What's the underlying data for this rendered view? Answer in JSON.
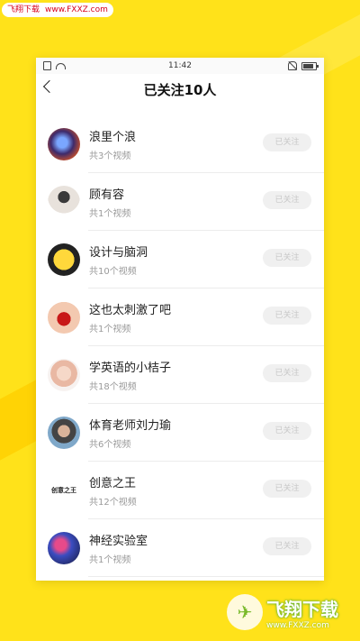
{
  "watermark": {
    "top_brand": "飞翔下载",
    "top_url": "www.FXXZ.com",
    "bottom_title": "飞翔下载",
    "bottom_url": "www.FXXZ.com"
  },
  "statusbar": {
    "time": "11:42"
  },
  "navbar": {
    "title": "已关注10人"
  },
  "list": {
    "items": [
      {
        "name": "浪里个浪",
        "count": "共3个视频",
        "button": "已关注"
      },
      {
        "name": "顾有容",
        "count": "共1个视频",
        "button": "已关注"
      },
      {
        "name": "设计与脑洞",
        "count": "共10个视频",
        "button": "已关注"
      },
      {
        "name": "这也太刺激了吧",
        "count": "共1个视频",
        "button": "已关注"
      },
      {
        "name": "学英语的小桔子",
        "count": "共18个视频",
        "button": "已关注"
      },
      {
        "name": "体育老师刘力瑜",
        "count": "共6个视频",
        "button": "已关注"
      },
      {
        "name": "创意之王",
        "count": "共12个视频",
        "button": "已关注"
      },
      {
        "name": "神经实验室",
        "count": "共1个视频",
        "button": "已关注"
      }
    ],
    "logo_text": "创意之王"
  },
  "colors": {
    "background": "#FFE21A",
    "button_bg": "#f0f0f0",
    "button_text": "#c8c8c8"
  }
}
